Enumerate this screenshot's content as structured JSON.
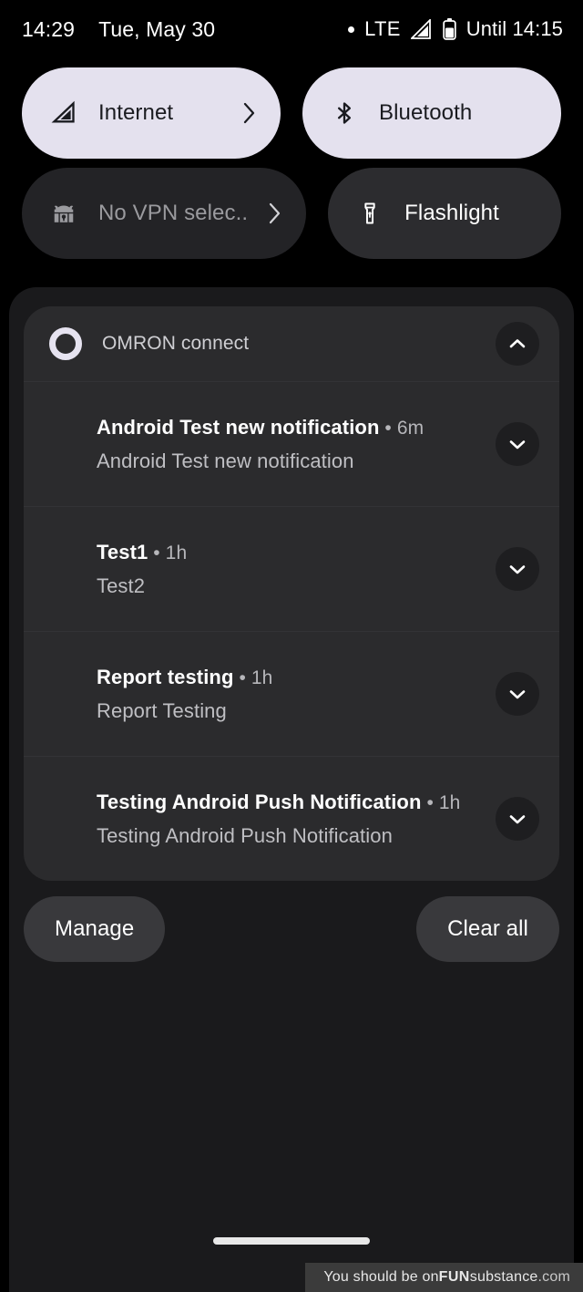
{
  "statusbar": {
    "time": "14:29",
    "date": "Tue, May 30",
    "network": "LTE",
    "battery_until": "Until 14:15"
  },
  "quick_settings": {
    "tiles": [
      {
        "label": "Internet",
        "icon": "signal-icon",
        "state": "on",
        "chevron": true
      },
      {
        "label": "Bluetooth",
        "icon": "bluetooth-icon",
        "state": "on",
        "chevron": false
      },
      {
        "label": "No VPN selec..",
        "icon": "vpn-key-icon",
        "state": "off",
        "chevron": true
      },
      {
        "label": "Flashlight",
        "icon": "flashlight-icon",
        "state": "lit",
        "chevron": false
      }
    ]
  },
  "notifications": {
    "app_name": "OMRON connect",
    "items": [
      {
        "title": "Android Test new notification",
        "time": "6m",
        "body": "Android Test new notification"
      },
      {
        "title": "Test1",
        "time": "1h",
        "body": "Test2"
      },
      {
        "title": "Report testing",
        "time": "1h",
        "body": "Report Testing"
      },
      {
        "title": "Testing Android Push Notification",
        "time": "1h",
        "body": "Testing Android Push Notification"
      }
    ],
    "manage_label": "Manage",
    "clear_label": "Clear all"
  },
  "watermark": {
    "prefix": "You should be on ",
    "brand_bold": "FUN",
    "brand_rest": "substance",
    "tld": ".com"
  },
  "colors": {
    "tile_active_bg": "#E4E1EE",
    "tile_inactive_bg": "#232326",
    "tile_lit_bg": "#2C2C2F",
    "shade_bg": "#1A1A1C",
    "card_bg": "#2B2B2D",
    "pill_bg": "#39393C"
  }
}
